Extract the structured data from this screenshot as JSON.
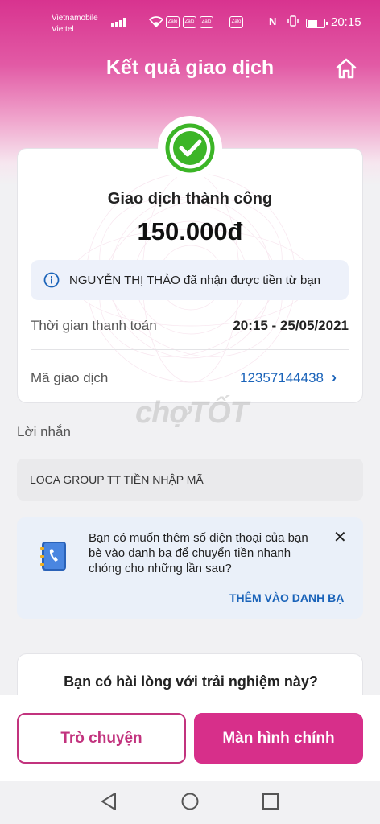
{
  "status_bar": {
    "carrier_1": "Vietnamobile",
    "carrier_2": "Viettel",
    "zalo_badges": [
      "Zalo",
      "Zalo",
      "Zalo",
      "Zalo"
    ],
    "nfc": "N",
    "time": "20:15"
  },
  "header": {
    "title": "Kết quả giao dịch",
    "home_icon": "home-icon"
  },
  "result": {
    "status": "Giao dịch thành công",
    "amount": "150.000đ",
    "info_message": "NGUYỄN THỊ THẢO đã nhận được tiền từ bạn",
    "payment_time_label": "Thời gian thanh toán",
    "payment_time_value": "20:15 - 25/05/2021",
    "transaction_id_label": "Mã giao dịch",
    "transaction_id_value": "12357144438"
  },
  "watermark": "chợTỐT",
  "message": {
    "label": "Lời nhắn",
    "text": "LOCA GROUP TT TIỀN NHẬP MÃ"
  },
  "contact_prompt": {
    "text": "Bạn có muốn thêm số điện thoại của bạn bè vào danh bạ để chuyển tiền nhanh chóng cho những lần sau?",
    "action": "THÊM VÀO DANH BẠ"
  },
  "survey": {
    "question": "Bạn có hài lòng với trải nghiệm này?"
  },
  "actions": {
    "chat": "Trò chuyện",
    "main_screen": "Màn hình chính"
  },
  "colors": {
    "brand_pink": "#d72f8a",
    "success_green": "#3cb527",
    "link_blue": "#1a63b9"
  }
}
